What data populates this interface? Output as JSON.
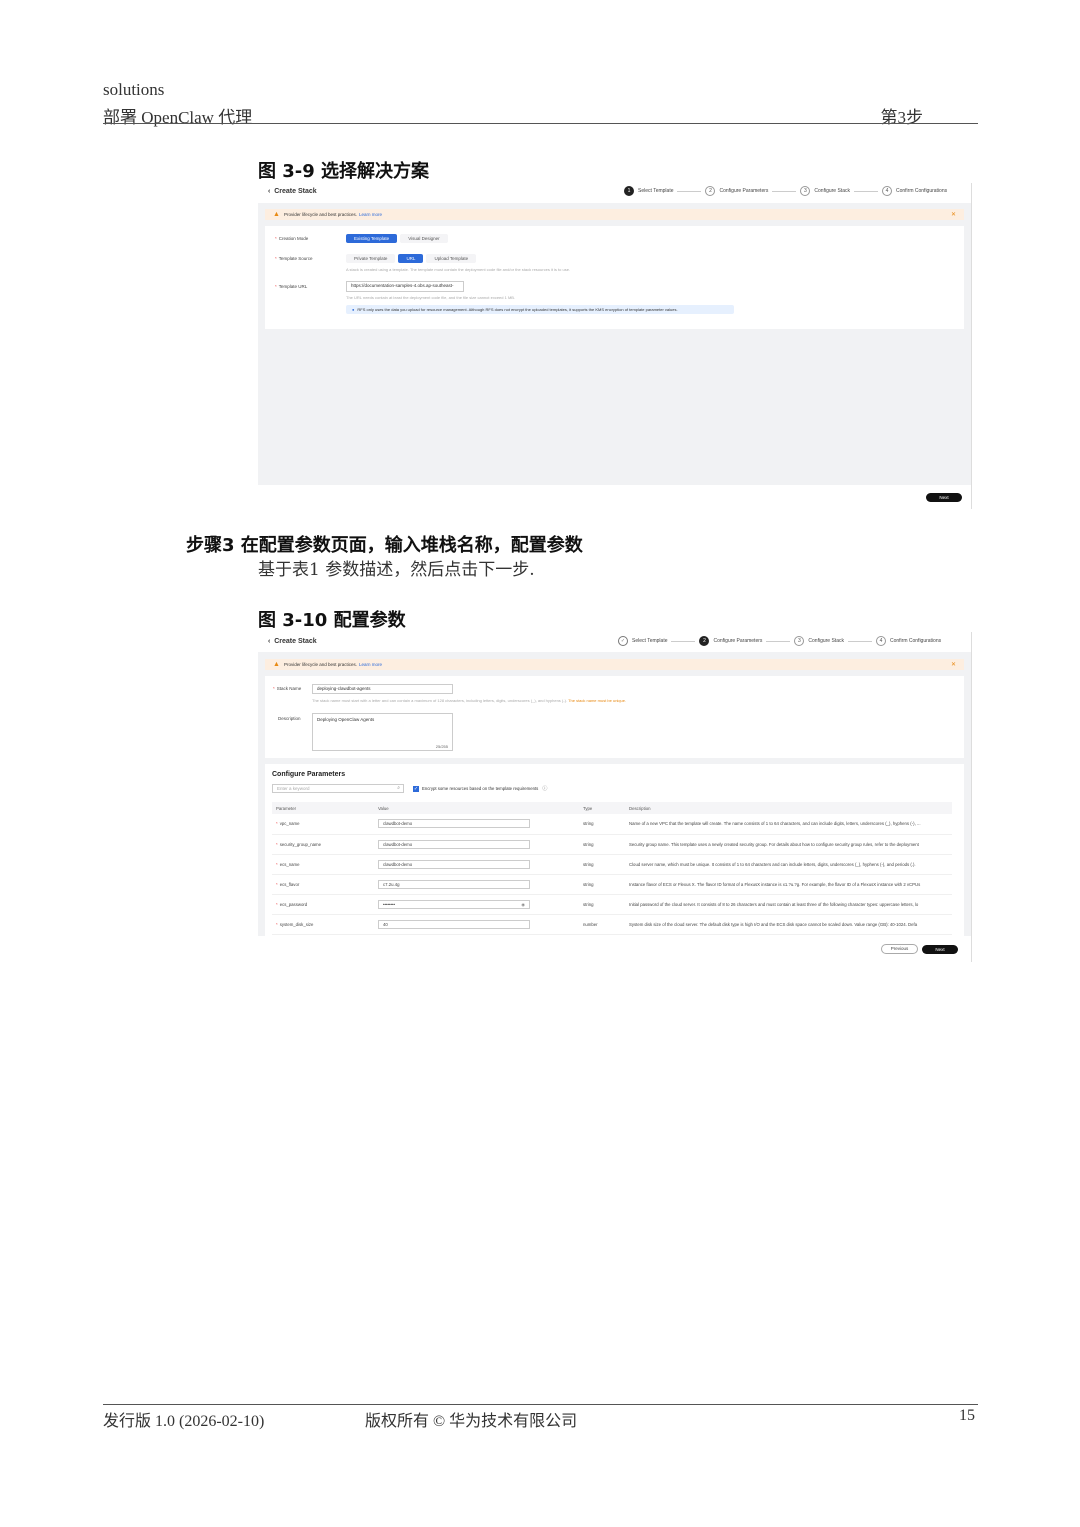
{
  "header": {
    "line1": "solutions",
    "line2": "部署 OpenClaw 代理",
    "step": "第3步"
  },
  "figure1": {
    "caption": "图 3-9 选择解决方案",
    "title": "Create Stack",
    "steps": [
      {
        "num": "1",
        "label": "Select Template"
      },
      {
        "num": "2",
        "label": "Configure Parameters"
      },
      {
        "num": "3",
        "label": "Configure Stack"
      },
      {
        "num": "4",
        "label": "Confirm Configurations"
      }
    ],
    "banner": "Provider lifecycle and best practices.",
    "banner_link": "Learn more",
    "creation_mode_label": "Creation Mode",
    "creation_modes": [
      "Existing Template",
      "Visual Designer"
    ],
    "template_source_label": "Template Source",
    "template_sources": [
      "Private Template",
      "URL",
      "Upload Template"
    ],
    "source_hint": "A stack is created using a template. The template must contain the deployment code file and/or the stack resources it is to use.",
    "template_url_label": "Template URL",
    "template_url_value": "https://documentation-samples-4.obs.ap-southeast-",
    "url_hint": "The URL needs contain at least the deployment code file, and the file size cannot exceed 1 MB.",
    "info": "RFS only uses the data you upload for resource management. Although RFS does not encrypt the uploaded templates, it supports the KMS encryption of template parameter values.",
    "next": "Next"
  },
  "step3": {
    "title": "步骤3 在配置参数页面，输入堆栈名称，配置参数",
    "text": "基于表1 参数描述，然后点击下一步."
  },
  "figure2": {
    "caption": "图 3-10 配置参数",
    "title": "Create Stack",
    "steps": [
      {
        "num": "✓",
        "label": "Select Template"
      },
      {
        "num": "2",
        "label": "Configure Parameters"
      },
      {
        "num": "3",
        "label": "Configure Stack"
      },
      {
        "num": "4",
        "label": "Confirm Configurations"
      }
    ],
    "banner": "Provider lifecycle and best practices.",
    "banner_link": "Learn more",
    "stack_name_label": "Stack Name",
    "stack_name_value": "deploying-clawdbot-agents",
    "stack_name_hint": "The stack name must start with a letter and can contain a maximum of 128 characters, including letters, digits, underscores (_), and hyphens (-).",
    "stack_name_warn": "The stack name must be unique.",
    "description_label": "Description",
    "description_value": "Deploying OpenClaw Agents",
    "description_count": "25/255",
    "params_title": "Configure Parameters",
    "search_placeholder": "Enter a keyword",
    "encrypt_label": "Encrypt some resources based on the template requirements",
    "columns": [
      "Parameter",
      "Value",
      "Type",
      "Description"
    ],
    "rows": [
      {
        "name": "vpc_name",
        "value": "clawdbot-demo",
        "type": "string",
        "desc": "Name of a new VPC that the template will create. The name consists of 1 to 64 characters, and can include digits, letters, underscores (_), hyphens (-), ..."
      },
      {
        "name": "security_group_name",
        "value": "clawdbot-demo",
        "type": "string",
        "desc": "Security group name. This template uses a newly created security group. For details about how to configure security group rules, refer to the deployment"
      },
      {
        "name": "ecs_name",
        "value": "clawdbot-demo",
        "type": "string",
        "desc": "Cloud server name, which must be unique. It consists of 1 to 64 characters and can include letters, digits, underscores (_), hyphens (-), and periods (.)."
      },
      {
        "name": "ecs_flavor",
        "value": "c7.2u.4g",
        "type": "string",
        "desc": "Instance flavor of ECS or Flexus X. The flavor ID format of a FlexusX instance is x1.?u.?g. For example, the flavor ID of a FlexusX instance with 2 vCPUs"
      },
      {
        "name": "ecs_password",
        "value": "••••••••",
        "type": "string",
        "desc": "Initial password of the cloud server. It consists of 8 to 26 characters and must contain at least three of the following character types: uppercase letters, lo"
      },
      {
        "name": "system_disk_size",
        "value": "40",
        "type": "number",
        "desc": "System disk size of the cloud server. The default disk type is high I/O and the ECS disk space cannot be scaled down. Value range (GB): 40-1024. Defa"
      }
    ],
    "previous": "Previous",
    "next": "Next"
  },
  "footer": {
    "edition": "发行版 1.0 (2026-02-10)",
    "copyright": "版权所有 © 华为技术有限公司",
    "page": "15"
  }
}
